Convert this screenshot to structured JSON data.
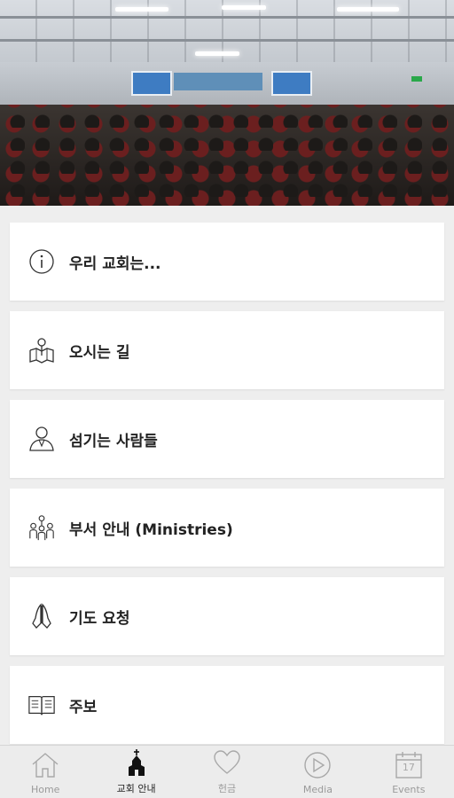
{
  "hero": {
    "image": "church-congregation-photo"
  },
  "menu": {
    "items": [
      {
        "label": "우리 교회는...",
        "icon": "info-icon"
      },
      {
        "label": "오시는 길",
        "icon": "map-pin-icon"
      },
      {
        "label": "섬기는 사람들",
        "icon": "person-icon"
      },
      {
        "label": "부서 안내 (Ministries)",
        "icon": "group-icon"
      },
      {
        "label": "기도 요청",
        "icon": "praying-hands-icon"
      },
      {
        "label": "주보",
        "icon": "book-icon"
      }
    ]
  },
  "tabbar": {
    "tabs": [
      {
        "label": "Home",
        "icon": "home-icon",
        "active": false
      },
      {
        "label": "교회 안내",
        "icon": "church-icon",
        "active": true
      },
      {
        "label": "헌금",
        "icon": "heart-icon",
        "active": false
      },
      {
        "label": "Media",
        "icon": "play-icon",
        "active": false
      },
      {
        "label": "Events",
        "icon": "calendar-icon",
        "active": false,
        "calendar_day": "17"
      }
    ]
  },
  "colors": {
    "background": "#eeeeee",
    "card": "#ffffff",
    "text": "#222222",
    "tab_inactive": "#9a9a9a",
    "tab_active": "#222222"
  }
}
